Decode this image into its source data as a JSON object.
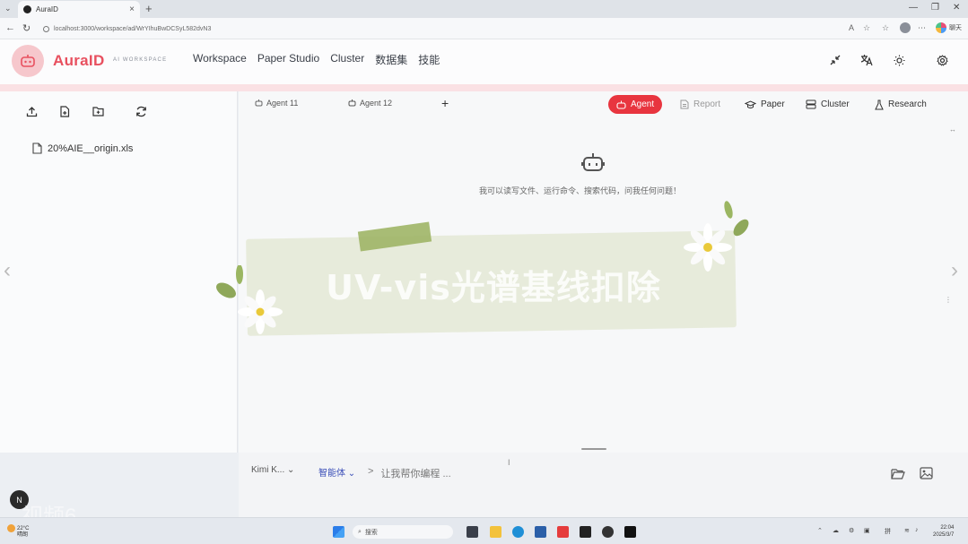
{
  "browser": {
    "tab_title": "AuraID",
    "url": "localhost:3000/workspace/ad/WrYIhuBwDCSyL582dvN3",
    "profile_label": "聊天"
  },
  "header": {
    "brand": "AuraID",
    "brand_sub": "AI WORKSPACE",
    "nav": [
      "Workspace",
      "Paper Studio",
      "Cluster",
      "数据集",
      "技能"
    ]
  },
  "sidebar": {
    "files": [
      "20%AIE__origin.xls"
    ]
  },
  "agent_tabs": [
    "Agent 11",
    "Agent 12"
  ],
  "modes": [
    {
      "label": "Agent",
      "state": "active"
    },
    {
      "label": "Report",
      "state": "dim"
    },
    {
      "label": "Paper",
      "state": "normal"
    },
    {
      "label": "Cluster",
      "state": "normal"
    },
    {
      "label": "Research",
      "state": "normal"
    }
  ],
  "welcome": "我可以读写文件、运行命令、搜索代码，问我任何问题！",
  "banner": {
    "title": "UV-vis光谱基线扣除"
  },
  "input": {
    "model": "Kimi K...",
    "agent_mode": "智能体",
    "prompt_symbol": ">",
    "placeholder": "让我帮你编程 ..."
  },
  "watermark": {
    "text": "视频6",
    "badge": "N"
  },
  "taskbar": {
    "weather_temp": "22°C",
    "weather_desc": "晴朗",
    "search_label": "搜索",
    "time": "22:04",
    "date": "2025/3/7"
  },
  "colors": {
    "brand": "#e8505f",
    "active_mode": "#e8353f",
    "agent_select": "#3b4fb8"
  }
}
